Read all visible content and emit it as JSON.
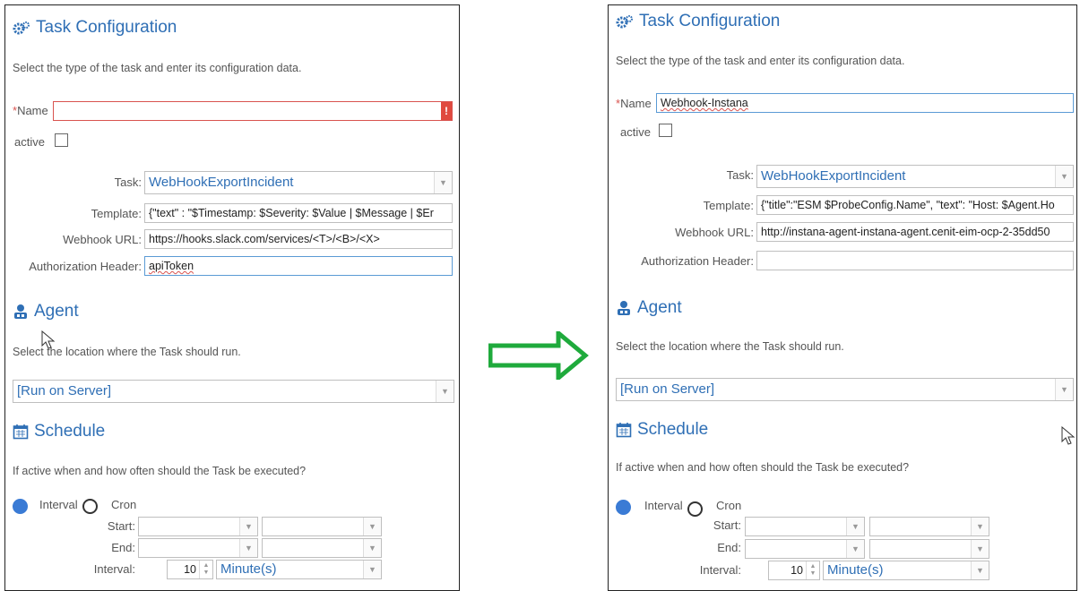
{
  "left": {
    "task_config": {
      "title": "Task Configuration",
      "desc": "Select the type of the task and enter its configuration data.",
      "name_req": "*",
      "name_label": "Name",
      "name_value": "",
      "error_mark": "!",
      "active_label": "active",
      "task_label": "Task:",
      "task_value": "WebHookExportIncident",
      "template_label": "Template:",
      "template_value": "{\"text\" : \"$Timestamp: $Severity: $Value | $Message | $Er",
      "webhook_label": "Webhook URL:",
      "webhook_value": "https://hooks.slack.com/services/<T>/<B>/<X>",
      "auth_label": "Authorization Header:",
      "auth_value": "apiToken"
    },
    "agent": {
      "title": "Agent",
      "desc": "Select the location where the Task should run.",
      "value": "[Run on Server]"
    },
    "schedule": {
      "title": "Schedule",
      "desc": "If active when and how often should the Task be executed?",
      "interval_opt": "Interval",
      "cron_opt": "Cron",
      "start_label": "Start:",
      "end_label": "End:",
      "interval_label": "Interval:",
      "interval_value": "10",
      "unit_value": "Minute(s)"
    }
  },
  "right": {
    "task_config": {
      "title": "Task Configuration",
      "desc": "Select the type of the task and enter its configuration data.",
      "name_req": "*",
      "name_label": "Name",
      "name_value": "Webhook-Instana",
      "active_label": "active",
      "task_label": "Task:",
      "task_value": "WebHookExportIncident",
      "template_label": "Template:",
      "template_value": "{\"title\":\"ESM $ProbeConfig.Name\", \"text\": \"Host: $Agent.Ho",
      "webhook_label": "Webhook URL:",
      "webhook_value": "http://instana-agent-instana-agent.cenit-eim-ocp-2-35dd50",
      "auth_label": "Authorization Header:",
      "auth_value": ""
    },
    "agent": {
      "title": "Agent",
      "desc": "Select the location where the Task should run.",
      "value": "[Run on Server]"
    },
    "schedule": {
      "title": "Schedule",
      "desc": "If active when and how often should the Task be executed?",
      "interval_opt": "Interval",
      "cron_opt": "Cron",
      "start_label": "Start:",
      "end_label": "End:",
      "interval_label": "Interval:",
      "interval_value": "10",
      "unit_value": "Minute(s)"
    }
  },
  "colors": {
    "accent": "#2f6fb5",
    "error": "#e04a3f",
    "arrow": "#1faa3c"
  },
  "icons": [
    "gears-icon",
    "agent-icon",
    "calendar-icon",
    "right-arrow-icon",
    "mouse-pointer-icon"
  ]
}
